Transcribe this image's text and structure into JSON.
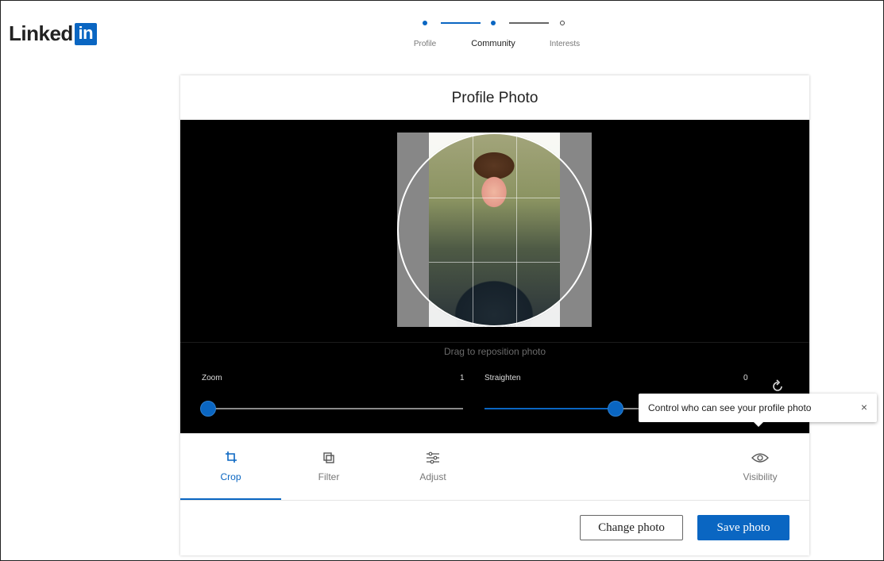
{
  "brand": {
    "wordmark": "Linked",
    "badge": "in",
    "color": "#0a66c2"
  },
  "stepper": {
    "steps": [
      {
        "label": "Profile",
        "state": "done"
      },
      {
        "label": "Community",
        "state": "current"
      },
      {
        "label": "Interests",
        "state": "todo"
      }
    ]
  },
  "dialog": {
    "title": "Profile Photo",
    "drag_hint": "Drag to reposition photo",
    "zoom": {
      "label": "Zoom",
      "value": "1",
      "level": 0.0
    },
    "straighten": {
      "label": "Straighten",
      "value": "0",
      "level": 0.5
    },
    "tabs": [
      {
        "label": "Crop",
        "icon": "crop-icon",
        "active": true
      },
      {
        "label": "Filter",
        "icon": "filter-icon",
        "active": false
      },
      {
        "label": "Adjust",
        "icon": "adjust-icon",
        "active": false
      },
      {
        "label": "Visibility",
        "icon": "eye-icon",
        "active": false
      }
    ],
    "buttons": {
      "change": "Change photo",
      "save": "Save photo"
    }
  },
  "tooltip": {
    "text": "Control who can see your profile photo",
    "close": "×"
  }
}
